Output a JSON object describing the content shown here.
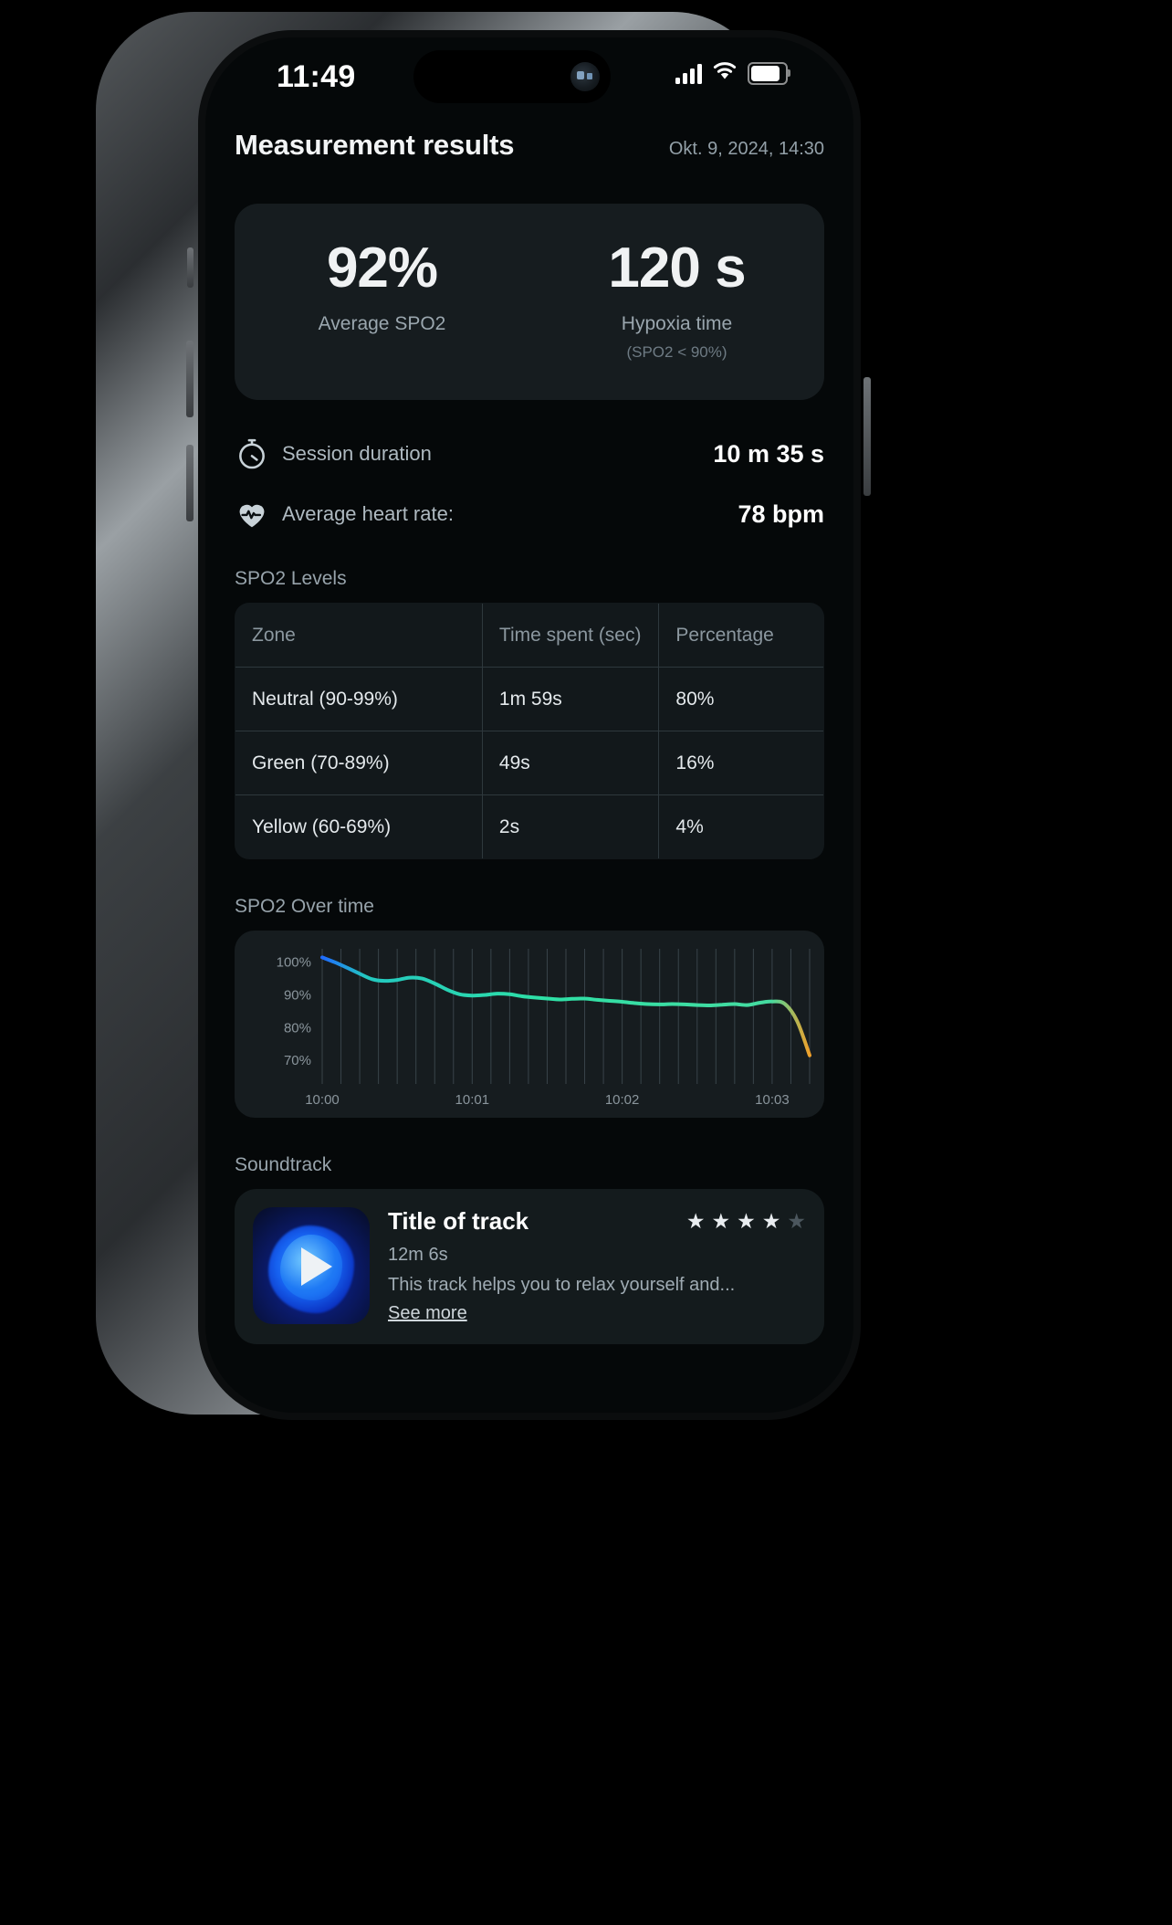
{
  "status_bar": {
    "time": "11:49",
    "signal_icon": "cellular-bars-icon",
    "wifi_icon": "wifi-icon",
    "battery_icon": "battery-icon"
  },
  "header": {
    "title": "Measurement results",
    "date": "Okt. 9, 2024, 14:30"
  },
  "summary": {
    "spo2_value": "92%",
    "spo2_label": "Average SPO2",
    "hypoxia_value": "120 s",
    "hypoxia_label": "Hypoxia time",
    "hypoxia_sub": "(SPO2 < 90%)"
  },
  "stats": {
    "duration_icon": "stopwatch-icon",
    "duration_label": "Session duration",
    "duration_value": "10 m 35 s",
    "heart_icon": "heart-pulse-icon",
    "heart_label": "Average heart rate:",
    "heart_value": "78 bpm"
  },
  "spo2_levels": {
    "section_title": "SPO2 Levels",
    "columns": [
      "Zone",
      "Time spent (sec)",
      "Percentage"
    ],
    "rows": [
      {
        "zone": "Neutral (90-99%)",
        "time": "1m 59s",
        "percentage": "80%"
      },
      {
        "zone": "Green (70-89%)",
        "time": "49s",
        "percentage": "16%"
      },
      {
        "zone": "Yellow (60-69%)",
        "time": "2s",
        "percentage": "4%"
      }
    ]
  },
  "chart_section": {
    "section_title": "SPO2 Over time"
  },
  "chart_data": {
    "type": "line",
    "title": "SPO2 Over time",
    "xlabel": "",
    "ylabel": "",
    "ylim": [
      65,
      103
    ],
    "yticks": [
      "100%",
      "90%",
      "80%",
      "70%"
    ],
    "ytick_values": [
      100,
      90,
      80,
      70
    ],
    "xticks": [
      "10:00",
      "10:01",
      "10:02",
      "10:03"
    ],
    "xtick_values": [
      0,
      60,
      120,
      180
    ],
    "grid": "vertical",
    "legend": "none",
    "line_colors": {
      "start": "#1f6bff",
      "mid": "#2ee0b0",
      "end": "#f0a02a"
    },
    "x": [
      0,
      5,
      10,
      15,
      20,
      25,
      30,
      35,
      40,
      45,
      50,
      55,
      60,
      65,
      70,
      75,
      80,
      85,
      90,
      95,
      100,
      105,
      110,
      115,
      120,
      125,
      130,
      135,
      140,
      145,
      150,
      155,
      160,
      165,
      170,
      175,
      180,
      185,
      190,
      195
    ],
    "values": [
      101.5,
      100,
      98.3,
      96.5,
      94.8,
      94.3,
      94.6,
      95.3,
      95.0,
      93.5,
      91.6,
      90.2,
      89.8,
      90.0,
      90.4,
      90.2,
      89.6,
      89.2,
      88.9,
      88.6,
      88.8,
      88.9,
      88.5,
      88.2,
      87.9,
      87.5,
      87.2,
      87.1,
      87.2,
      87.1,
      86.9,
      86.8,
      87.0,
      87.2,
      86.9,
      87.6,
      88.0,
      87.3,
      82.0,
      71.5
    ]
  },
  "soundtrack": {
    "section_title": "Soundtrack",
    "art_icon": "play-icon",
    "title": "Title of track",
    "duration": "12m 6s",
    "description": "This track helps you to relax yourself and...",
    "see_more": "See more",
    "rating": 4,
    "rating_max": 5,
    "star_icon": "star-icon"
  }
}
